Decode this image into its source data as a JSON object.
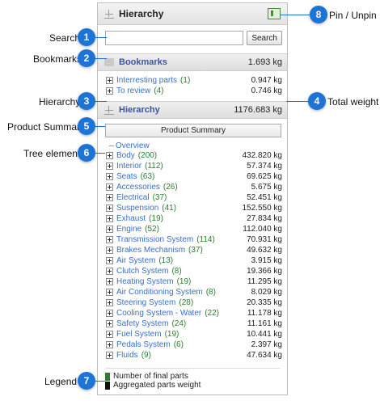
{
  "panel": {
    "title": "Hierarchy",
    "search_button": "Search",
    "search_value": "",
    "bookmarks": {
      "label": "Bookmarks",
      "weight": "1.693 kg",
      "items": [
        {
          "label": "Interresting parts",
          "count": "(1)",
          "weight": "0.947 kg"
        },
        {
          "label": "To review",
          "count": "(4)",
          "weight": "0.746 kg"
        }
      ]
    },
    "hierarchy": {
      "label": "Hierarchy",
      "weight": "1176.683 kg"
    },
    "product_summary": "Product Summary",
    "overview": "Overview",
    "tree": [
      {
        "label": "Body",
        "count": "(200)",
        "weight": "432.820 kg"
      },
      {
        "label": "Interior",
        "count": "(112)",
        "weight": "57.374 kg"
      },
      {
        "label": "Seats",
        "count": "(63)",
        "weight": "69.625 kg"
      },
      {
        "label": "Accessories",
        "count": "(26)",
        "weight": "5.675 kg"
      },
      {
        "label": "Electrical",
        "count": "(37)",
        "weight": "52.451 kg"
      },
      {
        "label": "Suspension",
        "count": "(41)",
        "weight": "152.550 kg"
      },
      {
        "label": "Exhaust",
        "count": "(19)",
        "weight": "27.834 kg"
      },
      {
        "label": "Engine",
        "count": "(52)",
        "weight": "112.040 kg"
      },
      {
        "label": "Transmission System",
        "count": "(114)",
        "weight": "70.931 kg"
      },
      {
        "label": "Brakes Mechanism",
        "count": "(37)",
        "weight": "49.632 kg"
      },
      {
        "label": "Air System",
        "count": "(13)",
        "weight": "3.915 kg"
      },
      {
        "label": "Clutch System",
        "count": "(8)",
        "weight": "19.366 kg"
      },
      {
        "label": "Heating System",
        "count": "(19)",
        "weight": "11.295 kg"
      },
      {
        "label": "Air Conditioning System",
        "count": "(8)",
        "weight": "8.029 kg"
      },
      {
        "label": "Steering System",
        "count": "(28)",
        "weight": "20.335 kg"
      },
      {
        "label": "Cooling System - Water",
        "count": "(22)",
        "weight": "11.178 kg"
      },
      {
        "label": "Safety System",
        "count": "(24)",
        "weight": "11.161 kg"
      },
      {
        "label": "Fuel System",
        "count": "(19)",
        "weight": "10.441 kg"
      },
      {
        "label": "Pedals System",
        "count": "(6)",
        "weight": "2.397 kg"
      },
      {
        "label": "Fluids",
        "count": "(9)",
        "weight": "47.634 kg"
      }
    ],
    "legend": [
      {
        "label": "Number of final parts",
        "color": "#2e7d32"
      },
      {
        "label": "Aggregated parts weight",
        "color": "#111111"
      }
    ]
  },
  "annotations": [
    {
      "num": "1",
      "label": "Search"
    },
    {
      "num": "2",
      "label": "Bookmarks"
    },
    {
      "num": "3",
      "label": "Hierarchy"
    },
    {
      "num": "4",
      "label": "Total weight"
    },
    {
      "num": "5",
      "label": "Product Summary"
    },
    {
      "num": "6",
      "label": "Tree elements"
    },
    {
      "num": "7",
      "label": "Legend"
    },
    {
      "num": "8",
      "label": "Pin / Unpin"
    }
  ]
}
